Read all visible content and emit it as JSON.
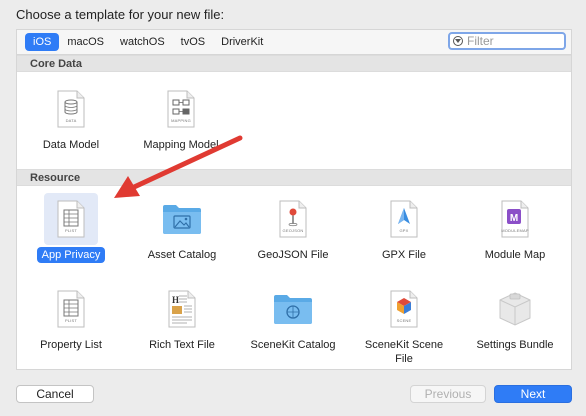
{
  "dialog": {
    "title": "Choose a template for your new file:"
  },
  "platforms": {
    "tabs": [
      "iOS",
      "macOS",
      "watchOS",
      "tvOS",
      "DriverKit"
    ],
    "selected": "iOS"
  },
  "filter": {
    "placeholder": "Filter",
    "value": ""
  },
  "sections": {
    "core_data": {
      "title": "Core Data",
      "items": [
        {
          "label": "Data Model",
          "icon": "data-model-document-icon",
          "caption": "DATA"
        },
        {
          "label": "Mapping Model",
          "icon": "mapping-model-document-icon",
          "caption": "MAPPING"
        }
      ]
    },
    "resource": {
      "title": "Resource",
      "items": [
        {
          "label": "App Privacy",
          "icon": "plist-document-icon",
          "caption": "PLIST",
          "selected": true
        },
        {
          "label": "Asset Catalog",
          "icon": "asset-catalog-folder-icon"
        },
        {
          "label": "GeoJSON File",
          "icon": "geojson-document-icon",
          "caption": "GEOJSON"
        },
        {
          "label": "GPX File",
          "icon": "gpx-document-icon",
          "caption": "GPX"
        },
        {
          "label": "Module Map",
          "icon": "module-map-document-icon",
          "caption": "MODULEMAP"
        },
        {
          "label": "Property List",
          "icon": "plist-document-icon",
          "caption": "PLIST"
        },
        {
          "label": "Rich Text File",
          "icon": "rich-text-document-icon"
        },
        {
          "label": "SceneKit Catalog",
          "icon": "scenekit-catalog-folder-icon"
        },
        {
          "label": "SceneKit Scene File",
          "icon": "scenekit-scene-document-icon",
          "caption": "SCENE"
        },
        {
          "label": "Settings Bundle",
          "icon": "settings-bundle-icon"
        }
      ]
    }
  },
  "buttons": {
    "cancel": "Cancel",
    "previous": "Previous",
    "next": "Next"
  },
  "colors": {
    "accent": "#2f7cf6",
    "annotation_arrow": "#e03a32",
    "selection_highlight": "#e2e9f7"
  }
}
